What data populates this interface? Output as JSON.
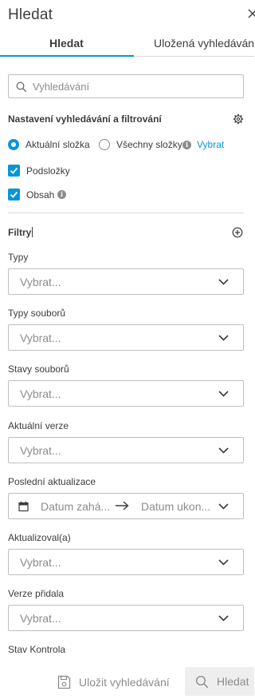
{
  "panel": {
    "title": "Hledat"
  },
  "tabs": [
    {
      "label": "Hledat",
      "active": true
    },
    {
      "label": "Uložená vyhledávání",
      "active": false
    }
  ],
  "search": {
    "placeholder": "Vyhledávání",
    "value": ""
  },
  "settings": {
    "title": "Nastavení vyhledávání a filtrování",
    "scope": {
      "current_folder": "Aktuální složka",
      "all_folders": "Všechny složky",
      "selected": "current_folder",
      "choose_link": "Vybrat"
    },
    "subfolders_label": "Podsložky",
    "subfolders_checked": true,
    "content_label": "Obsah",
    "content_checked": true
  },
  "filters": {
    "title": "Filtry",
    "fields": [
      {
        "label": "Typy",
        "placeholder": "Vybrat..."
      },
      {
        "label": "Typy souborů",
        "placeholder": "Vybrat..."
      },
      {
        "label": "Stavy souborů",
        "placeholder": "Vybrat..."
      },
      {
        "label": "Aktuální verze",
        "placeholder": "Vybrat..."
      }
    ],
    "last_updated": {
      "label": "Poslední aktualizace",
      "start_placeholder": "Datum zahá...",
      "end_placeholder": "Datum ukon..."
    },
    "more_fields": [
      {
        "label": "Aktualizoval(a)",
        "placeholder": "Vybrat..."
      },
      {
        "label": "Verze přidala",
        "placeholder": "Vybrat..."
      }
    ],
    "last_label": "Stav Kontrola"
  },
  "footer": {
    "save_label": "Uložit vyhledávání",
    "search_label": "Hledat"
  },
  "colors": {
    "accent": "#0696d7",
    "border": "#bfbfbf",
    "muted": "#8c8c8c"
  }
}
